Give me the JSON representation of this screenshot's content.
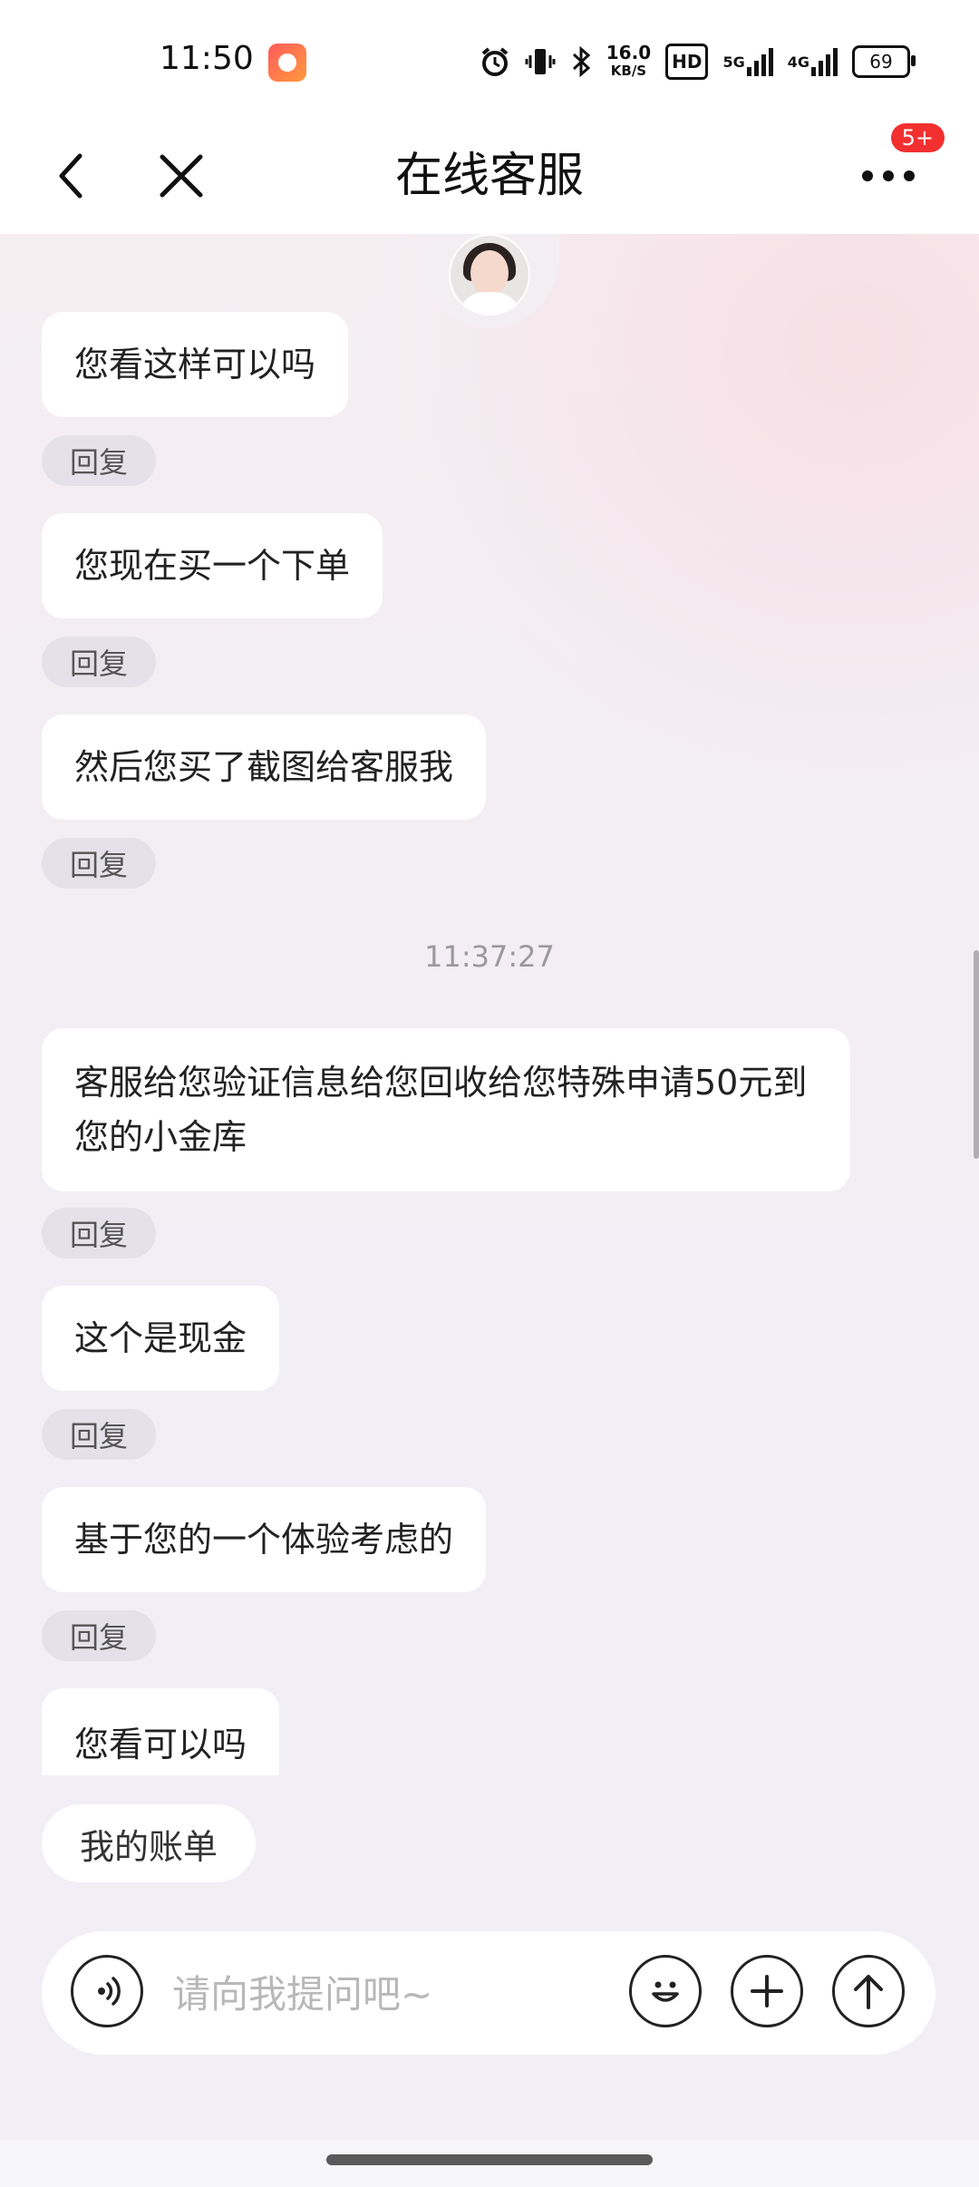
{
  "status_bar": {
    "time": "11:50",
    "net_speed_value": "16.0",
    "net_speed_unit": "KB/S",
    "hd_label": "HD",
    "signal_5g": "5G",
    "signal_4g": "4G",
    "battery": "69"
  },
  "header": {
    "title": "在线客服",
    "badge": "5+"
  },
  "messages": [
    {
      "text": "您看这样可以吗"
    },
    {
      "text": "您现在买一个下单"
    },
    {
      "text": "然后您买了截图给客服我"
    },
    {
      "text": "客服给您验证信息给您回收给您特殊申请50元到您的小金库"
    },
    {
      "text": "这个是现金"
    },
    {
      "text": "基于您的一个体验考虑的"
    },
    {
      "text": "您看可以吗"
    }
  ],
  "reply_label": "回复",
  "timestamp": "11:37:27",
  "shortcut": "我的账单",
  "input": {
    "placeholder": "请向我提问吧~",
    "value": ""
  }
}
